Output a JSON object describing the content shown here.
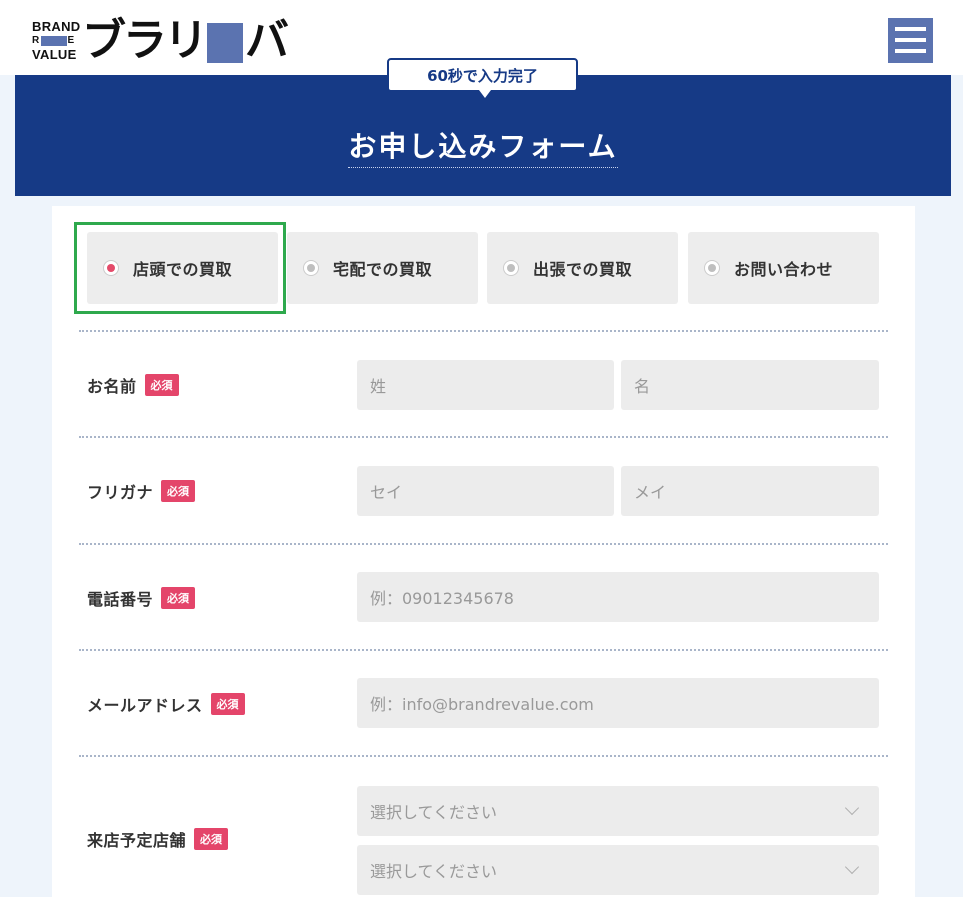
{
  "header": {
    "logo_small_line1": "BRAND",
    "logo_small_r": "R",
    "logo_small_e": "E",
    "logo_small_line3": "VALUE",
    "logo_kana_1": "ブラ",
    "logo_kana_2": "リ",
    "logo_kana_3": "バ",
    "menu_icon": "hamburger-icon"
  },
  "hero": {
    "badge": "60秒で入力完了",
    "title": "お申し込みフォーム"
  },
  "tabs": [
    {
      "label": "店頭での買取",
      "selected": true
    },
    {
      "label": "宅配での買取",
      "selected": false
    },
    {
      "label": "出張での買取",
      "selected": false
    },
    {
      "label": "お問い合わせ",
      "selected": false
    }
  ],
  "form": {
    "required_badge": "必須",
    "name": {
      "label": "お名前",
      "last_placeholder": "姓",
      "first_placeholder": "名"
    },
    "furigana": {
      "label": "フリガナ",
      "last_placeholder": "セイ",
      "first_placeholder": "メイ"
    },
    "phone": {
      "label": "電話番号",
      "placeholder": "例：09012345678"
    },
    "email": {
      "label": "メールアドレス",
      "placeholder": "例：info@brandrevalue.com"
    },
    "store": {
      "label": "来店予定店舗",
      "select1": "選択してください",
      "select2": "選択してください"
    }
  },
  "colors": {
    "accent": "#163a86",
    "menu": "#5b73b0",
    "required": "#e4456a",
    "selected_radio": "#e44b6a",
    "highlight": "#2ea94d"
  }
}
